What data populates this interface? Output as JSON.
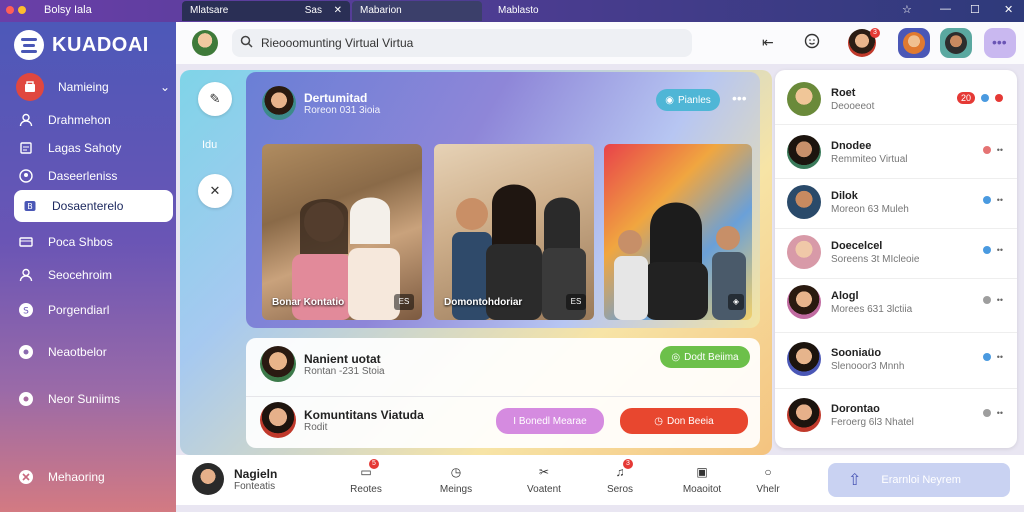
{
  "window": {
    "app_title": "Bolsy Iala",
    "tabs": [
      "Mlatsare",
      "Mabarion",
      "Mablasto"
    ],
    "tab1_meta": "Sas"
  },
  "sidebar": {
    "brand": "KUADOAI",
    "items": [
      {
        "label": "Namieing",
        "icon": "bag-icon"
      },
      {
        "label": "Drahmehon",
        "icon": "person-icon"
      },
      {
        "label": "Lagas Sahoty",
        "icon": "doc-icon"
      },
      {
        "label": "Daseerleniss",
        "icon": "contact-icon"
      },
      {
        "label": "Dosaenterelo",
        "icon": "tag-icon"
      },
      {
        "label": "Poca Shbos",
        "icon": "card-icon"
      },
      {
        "label": "Seocehroim",
        "icon": "person-icon"
      },
      {
        "label": "Porgendiarl",
        "icon": "globe-icon"
      },
      {
        "label": "Neaotbelor",
        "icon": "gear-icon"
      },
      {
        "label": "Neor Suniims",
        "icon": "gear-icon"
      },
      {
        "label": "Mehaoring",
        "icon": "x-icon"
      }
    ]
  },
  "header": {
    "search_text": "Rieooomunting Virtual Virtua",
    "badge_count": "3"
  },
  "main": {
    "rail_label": "Idu",
    "post": {
      "name": "Dertumitad",
      "sub": "Roreon 031 3ioia",
      "pill": "Pianles",
      "photos": [
        {
          "caption": "Bonar Kontatio",
          "tag": "ES"
        },
        {
          "caption": "Domontohdoriar",
          "tag": "ES"
        },
        {
          "caption": "",
          "tag": ""
        }
      ]
    },
    "cards": [
      {
        "title": "Nanient uotat",
        "sub": "Rontan -231 Stoia",
        "action": "Dodt Beiima"
      },
      {
        "title": "Komuntitans Viatuda",
        "sub": "Rodit",
        "action1": "I Bonedl Mearae",
        "action2": "Don Beeia"
      }
    ]
  },
  "contacts": [
    {
      "name": "Roet",
      "sub": "Deooeeot",
      "badge": "20"
    },
    {
      "name": "Dnodee",
      "sub": "Remmiteo Virtual",
      "badge": ""
    },
    {
      "name": "Dilok",
      "sub": "Moreon 63 Muleh",
      "badge": ""
    },
    {
      "name": "Doecelcel",
      "sub": "Soreens 3t MIcleoie",
      "badge": ""
    },
    {
      "name": "Alogl",
      "sub": "Morees 631 3lctiia",
      "badge": ""
    },
    {
      "name": "Sooniaüo",
      "sub": "Slenooor3 Mnnh",
      "badge": ""
    },
    {
      "name": "Dorontao",
      "sub": "Feroerg 6l3 Nhatel",
      "badge": ""
    }
  ],
  "bottombar": {
    "user_name": "Nagieln",
    "user_sub": "Fonteatis",
    "items": [
      {
        "label": "Reotes",
        "icon": "chat-icon",
        "badge": "5"
      },
      {
        "label": "Meings",
        "icon": "clock-icon",
        "badge": ""
      },
      {
        "label": "Voatent",
        "icon": "scissors-icon",
        "badge": ""
      },
      {
        "label": "Seros",
        "icon": "bell-icon",
        "badge": "3"
      },
      {
        "label": "Moaoitot",
        "icon": "image-icon",
        "badge": ""
      },
      {
        "label": "Vhelr",
        "icon": "circle-icon",
        "badge": ""
      }
    ],
    "cta": "Erarnloi Neyrem"
  },
  "colors": {
    "accent": "#4a57b6",
    "danger": "#e8472f",
    "success": "#6cc04a",
    "purple_pill": "#d58be0"
  }
}
